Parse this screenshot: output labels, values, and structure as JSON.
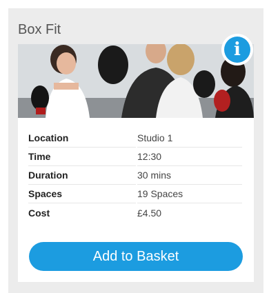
{
  "class_card": {
    "title": "Box Fit",
    "image_alt": "boxing-class-photo",
    "info_icon": "info-icon",
    "details": [
      {
        "label": "Location",
        "value": "Studio 1"
      },
      {
        "label": "Time",
        "value": "12:30"
      },
      {
        "label": "Duration",
        "value": "30 mins"
      },
      {
        "label": "Spaces",
        "value": "19 Spaces"
      },
      {
        "label": "Cost",
        "value": "£4.50"
      }
    ],
    "button_label": "Add to Basket"
  },
  "colors": {
    "accent": "#1c9ce0",
    "panel_bg": "#ececec"
  }
}
